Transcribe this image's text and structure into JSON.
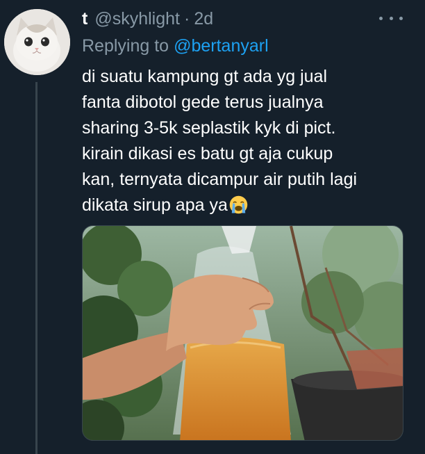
{
  "tweet": {
    "display_name": "t",
    "handle": "@skyhlight",
    "separator": "·",
    "time": "2d",
    "reply": {
      "prefix": "Replying to",
      "handle": "@bertanyarl"
    },
    "text_lines": [
      "di suatu kampung gt ada yg jual",
      "fanta dibotol gede terus jualnya",
      "sharing 3-5k seplastik kyk di pict.",
      "kirain dikasi es batu gt aja cukup",
      "kan, ternyata dicampur air putih lagi",
      "dikata sirup apa ya"
    ],
    "emoji": "loudly-crying-face-icon",
    "more_icon": "more-horizontal-icon"
  },
  "colors": {
    "background": "#15202b",
    "text_primary": "#ffffff",
    "text_secondary": "#8899a6",
    "accent": "#1da1f2",
    "divider": "#38444d"
  }
}
